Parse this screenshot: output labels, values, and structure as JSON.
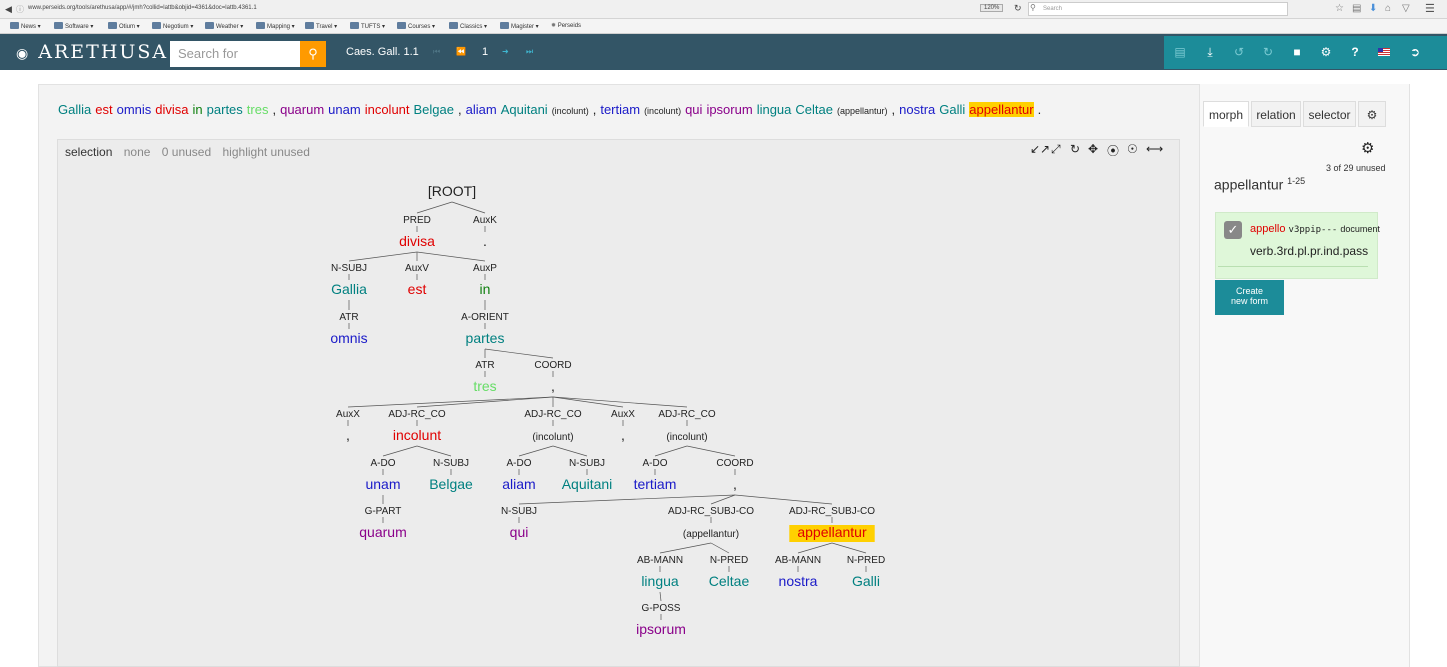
{
  "browser": {
    "url": "www.perseids.org/tools/arethusa/app/#/jmh?collid=lattb&objid=4361&doc=lattb.4361.1",
    "zoom": "120%",
    "search_placeholder": "Search",
    "bookmarks": [
      "News",
      "Software",
      "Otium",
      "Negotium",
      "Weather",
      "Mapping",
      "Travel",
      "TUFTS",
      "Courses",
      "Classics",
      "Magister",
      "Perseids"
    ]
  },
  "app": {
    "logo": "ARETHUSA",
    "search_placeholder": "Search for documents",
    "doc_title": "Caes. Gall. 1.1",
    "page_number": "1",
    "toolbar_icons": [
      "save-icon",
      "download-icon",
      "undo-icon",
      "redo-icon",
      "comment-icon",
      "settings-icon",
      "help-icon",
      "language-flag-icon",
      "logout-icon"
    ],
    "toolbar_labels": {
      "help": "?"
    }
  },
  "sentence": {
    "tokens": [
      {
        "text": "Gallia",
        "color": "#008080"
      },
      {
        "text": "est",
        "color": "#e00000"
      },
      {
        "text": "omnis",
        "color": "#1a1ac8"
      },
      {
        "text": "divisa",
        "color": "#e00000"
      },
      {
        "text": "in",
        "color": "#108010"
      },
      {
        "text": "partes",
        "color": "#008080"
      },
      {
        "text": "tres",
        "color": "#66dd66"
      },
      {
        "text": ",",
        "color": "#222222"
      },
      {
        "text": "quarum",
        "color": "#8a008a"
      },
      {
        "text": "unam",
        "color": "#1a1ac8"
      },
      {
        "text": "incolunt",
        "color": "#e00000"
      },
      {
        "text": "Belgae",
        "color": "#008080"
      },
      {
        "text": ",",
        "color": "#222222"
      },
      {
        "text": "aliam",
        "color": "#1a1ac8"
      },
      {
        "text": "Aquitani",
        "color": "#008080"
      },
      {
        "text": "(incolunt)",
        "color": "#222222",
        "small": true
      },
      {
        "text": ",",
        "color": "#222222"
      },
      {
        "text": "tertiam",
        "color": "#1a1ac8"
      },
      {
        "text": "(incolunt)",
        "color": "#222222",
        "small": true
      },
      {
        "text": "qui",
        "color": "#8a008a"
      },
      {
        "text": "ipsorum",
        "color": "#8a008a"
      },
      {
        "text": "lingua",
        "color": "#008080"
      },
      {
        "text": "Celtae",
        "color": "#008080"
      },
      {
        "text": "(appellantur)",
        "color": "#222222",
        "small": true
      },
      {
        "text": ",",
        "color": "#222222"
      },
      {
        "text": "nostra",
        "color": "#1a1ac8"
      },
      {
        "text": "Galli",
        "color": "#008080"
      },
      {
        "text": "appellantur",
        "color": "#e00000",
        "highlight": true
      },
      {
        "text": ".",
        "color": "#222222"
      }
    ]
  },
  "tree_panel": {
    "header": {
      "selection": "selection",
      "none": "none",
      "unused": "0 unused",
      "highlight": "highlight unused"
    },
    "controls": [
      "compress-icon",
      "expand-icon",
      "refresh-icon",
      "move-icon",
      "focus-icon",
      "center-icon",
      "horizontal-icon"
    ],
    "nodes": [
      {
        "id": "root",
        "word": "[ROOT]",
        "color": "#222222",
        "parent": null
      },
      {
        "id": "divisa",
        "word": "divisa",
        "label": "PRED",
        "color": "#e00000",
        "parent": "root"
      },
      {
        "id": "period",
        "word": ".",
        "label": "AuxK",
        "color": "#222222",
        "parent": "root"
      },
      {
        "id": "gallia",
        "word": "Gallia",
        "label": "N-SUBJ",
        "color": "#008080",
        "parent": "divisa"
      },
      {
        "id": "est",
        "word": "est",
        "label": "AuxV",
        "color": "#e00000",
        "parent": "divisa"
      },
      {
        "id": "in",
        "word": "in",
        "label": "AuxP",
        "color": "#108010",
        "parent": "divisa"
      },
      {
        "id": "omnis",
        "word": "omnis",
        "label": "ATR",
        "color": "#1a1ac8",
        "parent": "gallia"
      },
      {
        "id": "partes",
        "word": "partes",
        "label": "A-ORIENT",
        "color": "#008080",
        "parent": "in"
      },
      {
        "id": "tres",
        "word": "tres",
        "label": "ATR",
        "color": "#66dd66",
        "parent": "partes"
      },
      {
        "id": "coord1",
        "word": ",",
        "label": "COORD",
        "color": "#222222",
        "parent": "partes"
      },
      {
        "id": "comma1",
        "word": ",",
        "label": "AuxX",
        "color": "#222222",
        "parent": "coord1"
      },
      {
        "id": "incolunt",
        "word": "incolunt",
        "label": "ADJ-RC_CO",
        "color": "#e00000",
        "parent": "coord1"
      },
      {
        "id": "incolunt2",
        "word": "(incolunt)",
        "label": "ADJ-RC_CO",
        "color": "#222222",
        "parent": "coord1",
        "small": true
      },
      {
        "id": "comma2",
        "word": ",",
        "label": "AuxX",
        "color": "#222222",
        "parent": "coord1"
      },
      {
        "id": "incolunt3",
        "word": "(incolunt)",
        "label": "ADJ-RC_CO",
        "color": "#222222",
        "parent": "coord1",
        "small": true
      },
      {
        "id": "unam",
        "word": "unam",
        "label": "A-DO",
        "color": "#1a1ac8",
        "parent": "incolunt"
      },
      {
        "id": "belgae",
        "word": "Belgae",
        "label": "N-SUBJ",
        "color": "#008080",
        "parent": "incolunt"
      },
      {
        "id": "aliam",
        "word": "aliam",
        "label": "A-DO",
        "color": "#1a1ac8",
        "parent": "incolunt2"
      },
      {
        "id": "aquitani",
        "word": "Aquitani",
        "label": "N-SUBJ",
        "color": "#008080",
        "parent": "incolunt2"
      },
      {
        "id": "tertiam",
        "word": "tertiam",
        "label": "A-DO",
        "color": "#1a1ac8",
        "parent": "incolunt3"
      },
      {
        "id": "coord2",
        "word": ",",
        "label": "COORD",
        "color": "#222222",
        "parent": "incolunt3"
      },
      {
        "id": "quarum",
        "word": "quarum",
        "label": "G-PART",
        "color": "#8a008a",
        "parent": "unam"
      },
      {
        "id": "qui",
        "word": "qui",
        "label": "N-SUBJ",
        "color": "#8a008a",
        "parent": "coord2"
      },
      {
        "id": "appellantur2",
        "word": "(appellantur)",
        "label": "ADJ-RC_SUBJ-CO",
        "color": "#222222",
        "parent": "coord2",
        "small": true
      },
      {
        "id": "appellantur",
        "word": "appellantur",
        "label": "ADJ-RC_SUBJ-CO",
        "color": "#e00000",
        "parent": "coord2",
        "highlight": true
      },
      {
        "id": "lingua",
        "word": "lingua",
        "label": "AB-MANN",
        "color": "#008080",
        "parent": "appellantur2"
      },
      {
        "id": "celtae",
        "word": "Celtae",
        "label": "N-PRED",
        "color": "#008080",
        "parent": "appellantur2"
      },
      {
        "id": "nostra",
        "word": "nostra",
        "label": "AB-MANN",
        "color": "#1a1ac8",
        "parent": "appellantur"
      },
      {
        "id": "galli",
        "word": "Galli",
        "label": "N-PRED",
        "color": "#008080",
        "parent": "appellantur"
      },
      {
        "id": "ipsorum",
        "word": "ipsorum",
        "label": "G-POSS",
        "color": "#8a008a",
        "parent": "lingua"
      }
    ]
  },
  "right_panel": {
    "tabs": [
      "morph",
      "relation",
      "selector"
    ],
    "active_tab": "morph",
    "unused_count": "3 of 29 unused",
    "word": "appellantur",
    "word_sup": "1-25",
    "form": {
      "lemma": "appello",
      "postag": "v3ppip---",
      "source": "document",
      "description": "verb.3rd.pl.pr.ind.pass"
    },
    "create_button": "Create new form"
  },
  "colors": {
    "navbar": "#335566",
    "toolbar": "#1c8c99",
    "search_button": "#ff9a00",
    "highlight": "#ffd000"
  }
}
